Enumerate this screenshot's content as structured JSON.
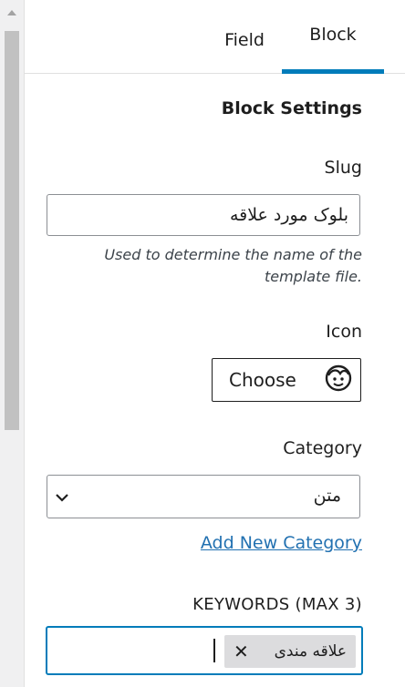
{
  "tabs": [
    {
      "label": "Field"
    },
    {
      "label": "Block"
    }
  ],
  "block_settings": {
    "title": "Block Settings",
    "slug": {
      "label": "Slug",
      "value": "بلوک مورد علاقه",
      "help": "Used to determine the name of the template file."
    },
    "icon": {
      "label": "Icon",
      "button_label": "Choose",
      "icon_name": "smiley-face-icon"
    },
    "category": {
      "label": "Category",
      "selected": "متن",
      "add_link": "Add New Category"
    },
    "keywords": {
      "label": "KEYWORDS (MAX 3)",
      "tokens": [
        "علاقه مندی"
      ]
    }
  },
  "colors": {
    "accent": "#007cba",
    "link": "#2271b1"
  }
}
